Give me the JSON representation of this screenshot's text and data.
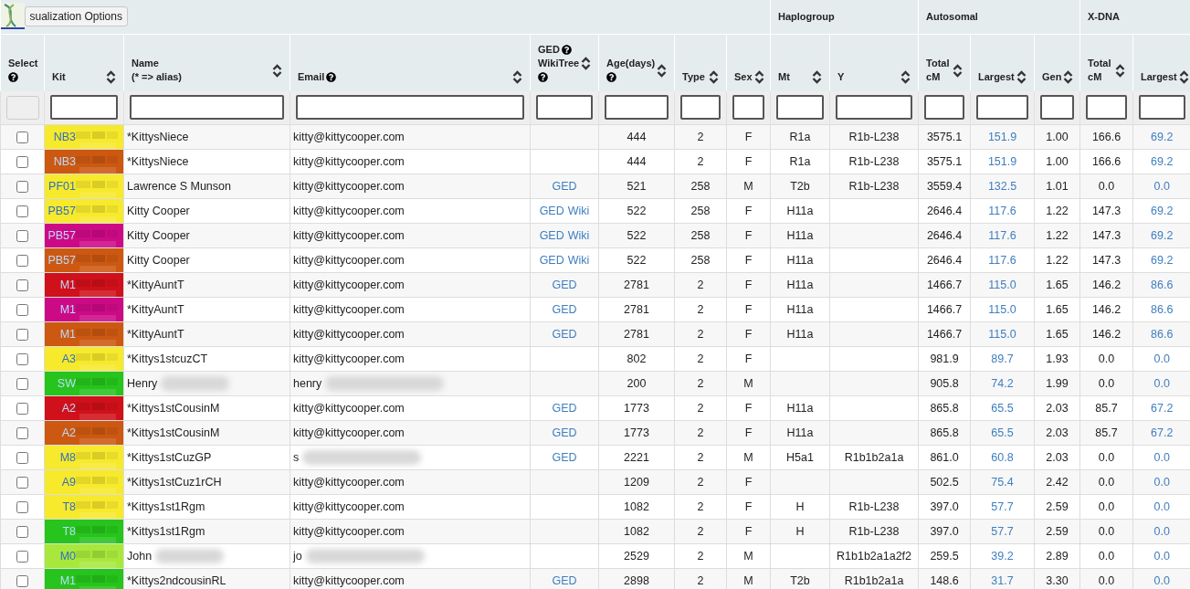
{
  "toolbar": {
    "button": "sualization Options"
  },
  "groups": [
    {
      "label": "Haplogroup"
    },
    {
      "label": "Autosomal"
    },
    {
      "label": "X-DNA"
    }
  ],
  "columns": [
    {
      "lines": [
        {
          "text": "Select"
        }
      ],
      "help_below": true,
      "sortable": false,
      "kind": "box"
    },
    {
      "lines": [
        {
          "text": "Kit"
        }
      ],
      "sortable": true,
      "kind": "field"
    },
    {
      "lines": [
        {
          "text": "Name"
        },
        {
          "text": "(* => alias)"
        }
      ],
      "sortable": true,
      "kind": "field"
    },
    {
      "lines": [
        {
          "text": "Email",
          "help": true
        }
      ],
      "sortable": true,
      "kind": "field"
    },
    {
      "lines": [
        {
          "text": "GED",
          "help": true
        },
        {
          "text": "WikiTree"
        }
      ],
      "help_below": true,
      "sortable": true,
      "kind": "field"
    },
    {
      "lines": [
        {
          "text": "Age(days)"
        }
      ],
      "help_below": true,
      "sortable": true,
      "kind": "field"
    },
    {
      "lines": [
        {
          "text": "Type"
        }
      ],
      "sortable": true,
      "kind": "field"
    },
    {
      "lines": [
        {
          "text": "Sex"
        }
      ],
      "sortable": true,
      "kind": "field"
    },
    {
      "lines": [
        {
          "text": "Mt"
        }
      ],
      "sortable": true,
      "kind": "field"
    },
    {
      "lines": [
        {
          "text": "Y"
        }
      ],
      "sortable": true,
      "kind": "field"
    },
    {
      "lines": [
        {
          "text": "Total"
        },
        {
          "text": "cM"
        }
      ],
      "sortable": true,
      "kind": "field"
    },
    {
      "lines": [
        {
          "text": "Largest"
        }
      ],
      "sortable": true,
      "kind": "field"
    },
    {
      "lines": [
        {
          "text": "Gen"
        }
      ],
      "sortable": true,
      "kind": "field"
    },
    {
      "lines": [
        {
          "text": "Total"
        },
        {
          "text": "cM"
        }
      ],
      "sortable": true,
      "kind": "field"
    },
    {
      "lines": [
        {
          "text": "Largest"
        }
      ],
      "sortable": true,
      "kind": "field"
    }
  ],
  "rows": [
    {
      "checked": false,
      "kit": "NB3",
      "color": "#f7e92c",
      "name": "*KittysNiece",
      "name_blurred": false,
      "email": "kitty@kittycooper.com",
      "email_blurred": false,
      "age": "444",
      "type": "2",
      "sex": "F",
      "mt": "R1a",
      "y": "R1b-L238",
      "total_cm": "3575.1",
      "largest": "151.9",
      "gen": "1.00",
      "x_total_cm": "166.6",
      "x_largest": "69.2"
    },
    {
      "checked": false,
      "kit": "NB3",
      "color": "#cc5812",
      "name": "*KittysNiece",
      "name_blurred": false,
      "email": "kitty@kittycooper.com",
      "email_blurred": false,
      "age": "444",
      "type": "2",
      "sex": "F",
      "mt": "R1a",
      "y": "R1b-L238",
      "total_cm": "3575.1",
      "largest": "151.9",
      "gen": "1.00",
      "x_total_cm": "166.6",
      "x_largest": "69.2"
    },
    {
      "checked": false,
      "kit": "PF01",
      "color": "#f7e92c",
      "name": "Lawrence S Munson",
      "name_blurred": false,
      "email": "kitty@kittycooper.com",
      "email_blurred": false,
      "ged": [
        "GED"
      ],
      "age": "521",
      "type": "258",
      "sex": "M",
      "mt": "T2b",
      "y": "R1b-L238",
      "total_cm": "3559.4",
      "largest": "132.5",
      "gen": "1.01",
      "x_total_cm": "0.0",
      "x_largest": "0.0"
    },
    {
      "checked": false,
      "kit": "PB57",
      "color": "#f7e92c",
      "name": "Kitty Cooper",
      "name_blurred": false,
      "email": "kitty@kittycooper.com",
      "email_blurred": false,
      "ged": [
        "GED",
        "Wiki"
      ],
      "age": "522",
      "type": "258",
      "sex": "F",
      "mt": "H11a",
      "total_cm": "2646.4",
      "largest": "117.6",
      "gen": "1.22",
      "x_total_cm": "147.3",
      "x_largest": "69.2"
    },
    {
      "checked": false,
      "kit": "PB57",
      "color": "#cc0a86",
      "name": "Kitty Cooper",
      "name_blurred": false,
      "email": "kitty@kittycooper.com",
      "email_blurred": false,
      "ged": [
        "GED",
        "Wiki"
      ],
      "age": "522",
      "type": "258",
      "sex": "F",
      "mt": "H11a",
      "total_cm": "2646.4",
      "largest": "117.6",
      "gen": "1.22",
      "x_total_cm": "147.3",
      "x_largest": "69.2"
    },
    {
      "checked": false,
      "kit": "PB57",
      "color": "#cc5812",
      "name": "Kitty Cooper",
      "name_blurred": false,
      "email": "kitty@kittycooper.com",
      "email_blurred": false,
      "ged": [
        "GED",
        "Wiki"
      ],
      "age": "522",
      "type": "258",
      "sex": "F",
      "mt": "H11a",
      "total_cm": "2646.4",
      "largest": "117.6",
      "gen": "1.22",
      "x_total_cm": "147.3",
      "x_largest": "69.2"
    },
    {
      "checked": false,
      "kit": "M1",
      "color": "#d0101a",
      "name": "*KittyAuntT",
      "name_blurred": false,
      "email": "kitty@kittycooper.com",
      "email_blurred": false,
      "ged": [
        "GED"
      ],
      "age": "2781",
      "type": "2",
      "sex": "F",
      "mt": "H11a",
      "total_cm": "1466.7",
      "largest": "115.0",
      "gen": "1.65",
      "x_total_cm": "146.2",
      "x_largest": "86.6"
    },
    {
      "checked": false,
      "kit": "M1",
      "color": "#cc0a86",
      "name": "*KittyAuntT",
      "name_blurred": false,
      "email": "kitty@kittycooper.com",
      "email_blurred": false,
      "ged": [
        "GED"
      ],
      "age": "2781",
      "type": "2",
      "sex": "F",
      "mt": "H11a",
      "total_cm": "1466.7",
      "largest": "115.0",
      "gen": "1.65",
      "x_total_cm": "146.2",
      "x_largest": "86.6"
    },
    {
      "checked": false,
      "kit": "M1",
      "color": "#cc5812",
      "name": "*KittyAuntT",
      "name_blurred": false,
      "email": "kitty@kittycooper.com",
      "email_blurred": false,
      "ged": [
        "GED"
      ],
      "age": "2781",
      "type": "2",
      "sex": "F",
      "mt": "H11a",
      "total_cm": "1466.7",
      "largest": "115.0",
      "gen": "1.65",
      "x_total_cm": "146.2",
      "x_largest": "86.6"
    },
    {
      "checked": false,
      "kit": "A3",
      "color": "#f7e92c",
      "name": "*Kittys1stcuzCT",
      "name_blurred": false,
      "email": "kitty@kittycooper.com",
      "email_blurred": false,
      "age": "802",
      "type": "2",
      "sex": "F",
      "total_cm": "981.9",
      "largest": "89.7",
      "gen": "1.93",
      "x_total_cm": "0.0",
      "x_largest": "0.0"
    },
    {
      "checked": false,
      "kit": "SW",
      "color": "#26c41c",
      "name": "Henry",
      "name_blurred": true,
      "email": "henry",
      "email_blurred": true,
      "age": "200",
      "type": "2",
      "sex": "M",
      "total_cm": "905.8",
      "largest": "74.2",
      "gen": "1.99",
      "x_total_cm": "0.0",
      "x_largest": "0.0"
    },
    {
      "checked": false,
      "kit": "A2",
      "color": "#d0101a",
      "name": "*Kittys1stCousinM",
      "name_blurred": false,
      "email": "kitty@kittycooper.com",
      "email_blurred": false,
      "ged": [
        "GED"
      ],
      "age": "1773",
      "type": "2",
      "sex": "F",
      "mt": "H11a",
      "total_cm": "865.8",
      "largest": "65.5",
      "gen": "2.03",
      "x_total_cm": "85.7",
      "x_largest": "67.2"
    },
    {
      "checked": false,
      "kit": "A2",
      "color": "#cc5812",
      "name": "*Kittys1stCousinM",
      "name_blurred": false,
      "email": "kitty@kittycooper.com",
      "email_blurred": false,
      "ged": [
        "GED"
      ],
      "age": "1773",
      "type": "2",
      "sex": "F",
      "mt": "H11a",
      "total_cm": "865.8",
      "largest": "65.5",
      "gen": "2.03",
      "x_total_cm": "85.7",
      "x_largest": "67.2"
    },
    {
      "checked": false,
      "kit": "M8",
      "color": "#f7e92c",
      "name": "*Kittys1stCuzGP",
      "name_blurred": false,
      "email": "s",
      "email_blurred": true,
      "ged": [
        "GED"
      ],
      "age": "2221",
      "type": "2",
      "sex": "M",
      "mt": "H5a1",
      "y": "R1b1b2a1a",
      "total_cm": "861.0",
      "largest": "60.8",
      "gen": "2.03",
      "x_total_cm": "0.0",
      "x_largest": "0.0"
    },
    {
      "checked": false,
      "kit": "A9",
      "color": "#f7e92c",
      "name": "*Kittys1stCuz1rCH",
      "name_blurred": false,
      "email": "kitty@kittycooper.com",
      "email_blurred": false,
      "age": "1209",
      "type": "2",
      "sex": "F",
      "total_cm": "502.5",
      "largest": "75.4",
      "gen": "2.42",
      "x_total_cm": "0.0",
      "x_largest": "0.0"
    },
    {
      "checked": false,
      "kit": "T8",
      "color": "#f7e92c",
      "name": "*Kittys1st1Rgm",
      "name_blurred": false,
      "email": "kitty@kittycooper.com",
      "email_blurred": false,
      "age": "1082",
      "type": "2",
      "sex": "F",
      "mt": "H",
      "y": "R1b-L238",
      "total_cm": "397.0",
      "largest": "57.7",
      "gen": "2.59",
      "x_total_cm": "0.0",
      "x_largest": "0.0"
    },
    {
      "checked": false,
      "kit": "T8",
      "color": "#26c41c",
      "name": "*Kittys1st1Rgm",
      "name_blurred": false,
      "email": "kitty@kittycooper.com",
      "email_blurred": false,
      "age": "1082",
      "type": "2",
      "sex": "F",
      "mt": "H",
      "y": "R1b-L238",
      "total_cm": "397.0",
      "largest": "57.7",
      "gen": "2.59",
      "x_total_cm": "0.0",
      "x_largest": "0.0"
    },
    {
      "checked": false,
      "kit": "M0",
      "color": "#a8e83c",
      "name": "John",
      "name_blurred": true,
      "email": "jo",
      "email_blurred": true,
      "age": "2529",
      "type": "2",
      "sex": "M",
      "y": "R1b1b2a1a2f2",
      "total_cm": "259.5",
      "largest": "39.2",
      "gen": "2.89",
      "x_total_cm": "0.0",
      "x_largest": "0.0"
    },
    {
      "checked": false,
      "kit": "M1",
      "color": "#26c41c",
      "name": "*Kittys2ndcousinRL",
      "name_blurred": false,
      "email": "kitty@kittycooper.com",
      "email_blurred": false,
      "ged": [
        "GED"
      ],
      "age": "2898",
      "type": "2",
      "sex": "M",
      "mt": "T2b",
      "y": "R1b1b2a1a",
      "total_cm": "148.6",
      "largest": "31.7",
      "gen": "3.30",
      "x_total_cm": "0.0",
      "x_largest": "0.0"
    }
  ]
}
